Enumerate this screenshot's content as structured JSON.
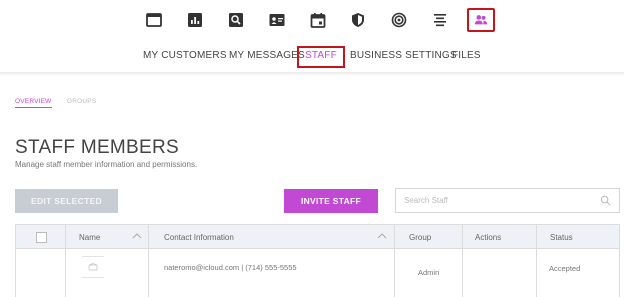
{
  "top_nav": {
    "icons": [
      {
        "name": "window-icon"
      },
      {
        "name": "bar-chart-icon"
      },
      {
        "name": "search-box-icon"
      },
      {
        "name": "contact-card-icon"
      },
      {
        "name": "calendar-icon"
      },
      {
        "name": "shield-icon"
      },
      {
        "name": "target-icon"
      },
      {
        "name": "text-align-icon"
      },
      {
        "name": "people-icon"
      }
    ],
    "accent": "#c249d3",
    "highlight": "#c0171e"
  },
  "text_nav": {
    "items": [
      "MY CUSTOMERS",
      "MY MESSAGES",
      "STAFF",
      "BUSINESS SETTINGS",
      "FILES"
    ]
  },
  "subtabs": [
    "OVERVIEW",
    "GROUPS"
  ],
  "page": {
    "title": "STAFF MEMBERS",
    "subtitle": "Manage staff member information and permissions."
  },
  "actions": {
    "edit_label": "EDIT SELECTED",
    "invite_label": "INVITE STAFF"
  },
  "search": {
    "placeholder": "Search Staff"
  },
  "table": {
    "columns": [
      "Name",
      "Contact Information",
      "Group",
      "Actions",
      "Status"
    ],
    "rows": [
      {
        "contact": "nateromo@icloud.com  |  (714) 555-5555",
        "group": "Admin",
        "status": "Accepted"
      }
    ]
  }
}
